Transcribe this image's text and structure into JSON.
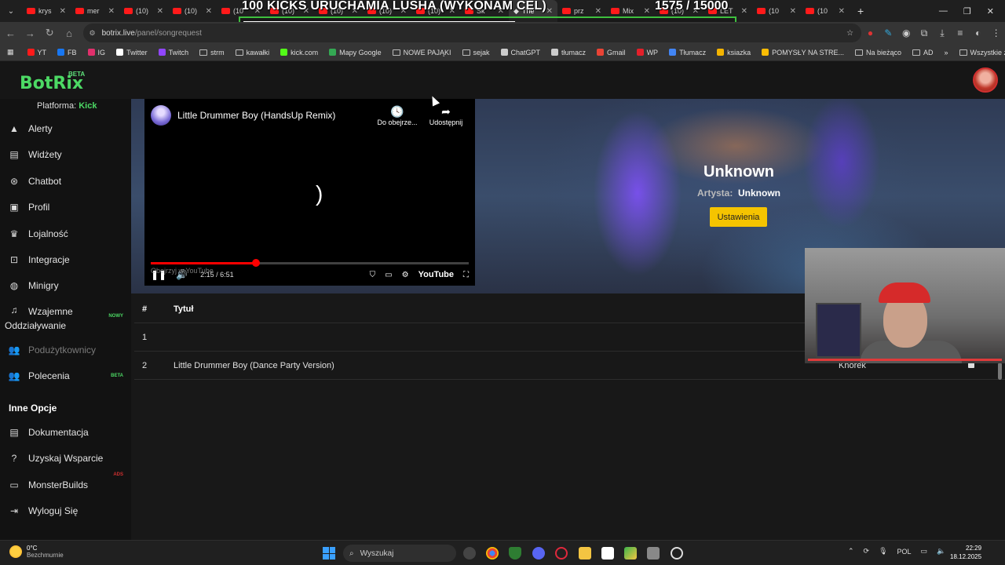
{
  "browser": {
    "tabs": [
      {
        "label": "krys",
        "icon": "youtube-icon"
      },
      {
        "label": "mer",
        "icon": "youtube-icon"
      },
      {
        "label": "(10)",
        "icon": "youtube-icon"
      },
      {
        "label": "(10)",
        "icon": "youtube-icon"
      },
      {
        "label": "(10",
        "icon": "youtube-icon"
      },
      {
        "label": "(10)",
        "icon": "youtube-icon"
      },
      {
        "label": "(10)",
        "icon": "youtube-icon"
      },
      {
        "label": "(10)",
        "icon": "youtube-icon"
      },
      {
        "label": "(10)",
        "icon": "youtube-icon"
      },
      {
        "label": "Sk",
        "icon": "youtube-icon"
      },
      {
        "label": "The",
        "icon": "botrix-icon",
        "active": true
      },
      {
        "label": "prz",
        "icon": "youtube-icon"
      },
      {
        "label": "Mix",
        "icon": "youtube-icon"
      },
      {
        "label": "(10)",
        "icon": "youtube-icon"
      },
      {
        "label": "LET",
        "icon": "youtube-icon"
      },
      {
        "label": "(10",
        "icon": "youtube-icon"
      },
      {
        "label": "(10",
        "icon": "youtube-icon"
      }
    ],
    "url_host": "botrix.live",
    "url_path": "/panel/songrequest",
    "overlay_title": "100 KICKS URUCHAMIA LUSHA (WYKONAM CEL)",
    "overlay_count": "1575  / 15000",
    "overlay_progress": 0.105,
    "bookmarks": [
      {
        "label": "YT",
        "color": "#ff1a1a"
      },
      {
        "label": "FB",
        "color": "#1877f2"
      },
      {
        "label": "IG",
        "color": "#e1306c"
      },
      {
        "label": "Twitter",
        "color": "#ffffff"
      },
      {
        "label": "Twitch",
        "color": "#9146ff"
      },
      {
        "label": "strm",
        "folder": true
      },
      {
        "label": "kawałki",
        "folder": true
      },
      {
        "label": "kick.com",
        "color": "#53fc18"
      },
      {
        "label": "Mapy Google",
        "color": "#34a853"
      },
      {
        "label": "NOWE PAJĄKI",
        "folder": true
      },
      {
        "label": "sejak",
        "folder": true
      },
      {
        "label": "ChatGPT",
        "color": "#cccccc"
      },
      {
        "label": "tłumacz",
        "color": "#cccccc"
      },
      {
        "label": "Gmail",
        "color": "#ea4335"
      },
      {
        "label": "WP",
        "color": "#e4202a"
      },
      {
        "label": "Tłumacz",
        "color": "#4285f4"
      },
      {
        "label": "ksiazka",
        "color": "#f4b400"
      },
      {
        "label": "POMYSŁY NA STRE...",
        "color": "#fbbc04"
      },
      {
        "label": "Na bieżąco",
        "folder": true
      },
      {
        "label": "AD",
        "folder": true
      }
    ],
    "all_bookmarks_label": "Wszystkie zakładki"
  },
  "app": {
    "logo": "BotRix",
    "logo_badge": "BETA",
    "platform_label": "Platforma:",
    "platform_value": "Kick",
    "nav": [
      {
        "label": "Alerty",
        "icon": "warning-icon"
      },
      {
        "label": "Widżety",
        "icon": "grid-icon"
      },
      {
        "label": "Chatbot",
        "icon": "robot-icon"
      },
      {
        "label": "Profil",
        "icon": "id-card-icon"
      },
      {
        "label": "Lojalność",
        "icon": "trophy-icon"
      },
      {
        "label": "Integracje",
        "icon": "plug-icon"
      },
      {
        "label": "Minigry",
        "icon": "gamepad-icon"
      },
      {
        "label": "Wzajemne",
        "label2": "Oddziaływanie",
        "icon": "music-icon",
        "tag": "NOWY"
      },
      {
        "label": "Podużytkownicy",
        "icon": "users-icon",
        "dim": true
      },
      {
        "label": "Polecenia",
        "icon": "users-icon",
        "tag": "BETA"
      }
    ],
    "other_header": "Inne Opcje",
    "other_nav": [
      {
        "label": "Dokumentacja",
        "icon": "book-icon"
      },
      {
        "label": "Uzyskaj Wsparcie",
        "icon": "question-icon"
      },
      {
        "label": "MonsterBuilds",
        "icon": "laptop-icon",
        "tag": "ADS"
      },
      {
        "label": "Wyloguj Się",
        "icon": "logout-icon"
      }
    ]
  },
  "player": {
    "title": "Little Drummer Boy (HandsUp Remix)",
    "watch_later": "Do obejrze...",
    "share": "Udostępnij",
    "time": "2:15 / 6:51",
    "ghost": "Obejrzyj w  YouTube",
    "logo": "YouTube",
    "progress": 0.33
  },
  "now_playing": {
    "title": "Unknown",
    "artist_label": "Artysta:",
    "artist_value": "Unknown",
    "settings_button": "Ustawienia"
  },
  "queue": {
    "col_num": "#",
    "col_title": "Tytuł",
    "rows": [
      {
        "num": "1",
        "title": "",
        "user": ""
      },
      {
        "num": "2",
        "title": "Little Drummer Boy (Dance Party Version)",
        "user": "Knorek"
      }
    ]
  },
  "taskbar": {
    "temp": "0°C",
    "weather": "Bezchmurnie",
    "search": "Wyszukaj",
    "lang": "POL",
    "time": "22:29",
    "date": "18.12.2025"
  }
}
